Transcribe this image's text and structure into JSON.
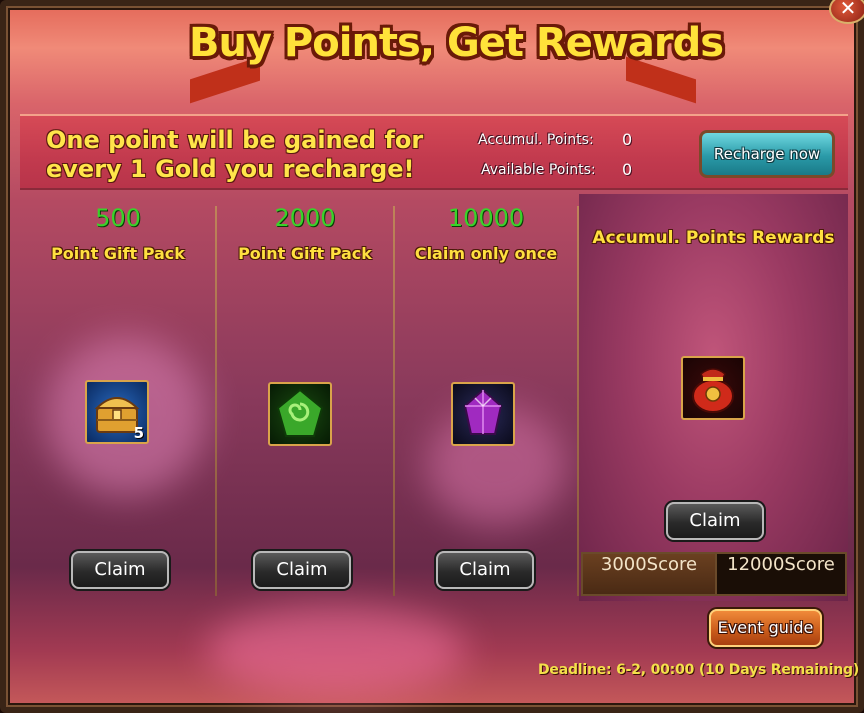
{
  "window": {
    "title": "Buy Points, Get Rewards",
    "close_icon": "close-icon",
    "close_symbol": "✕"
  },
  "info": {
    "line1": "One point will be gained for",
    "line2": "every 1 Gold you recharge!",
    "accumul_label": "Accumul. Points:",
    "accumul_value": "0",
    "available_label": "Available Points:",
    "available_value": "0",
    "recharge_label": "Recharge now"
  },
  "columns": [
    {
      "value": "500",
      "label": "Point Gift Pack",
      "item_icon": "treasure-chest-icon",
      "item_count": "5",
      "claim_label": "Claim"
    },
    {
      "value": "2000",
      "label": "Point Gift Pack",
      "item_icon": "green-jade-icon",
      "item_count": "",
      "claim_label": "Claim"
    },
    {
      "value": "10000",
      "label": "Claim only once",
      "item_icon": "purple-crystal-icon",
      "item_count": "",
      "claim_label": "Claim"
    }
  ],
  "rewards": {
    "title": "Accumul. Points Rewards",
    "item_icon": "red-lucky-bag-icon",
    "claim_label": "Claim",
    "tabs": [
      {
        "label": "3000Score",
        "active": true
      },
      {
        "label": "12000Score",
        "active": false
      }
    ]
  },
  "footer": {
    "event_guide_label": "Event guide",
    "deadline": "Deadline: 6-2, 00:00 (10 Days Remaining)"
  },
  "colors": {
    "title": "#ffe23a",
    "points_value": "#3ad22a",
    "label_gold": "#ffe040",
    "recharge_button": "#2a9aa8",
    "event_button": "#c85a1a"
  }
}
